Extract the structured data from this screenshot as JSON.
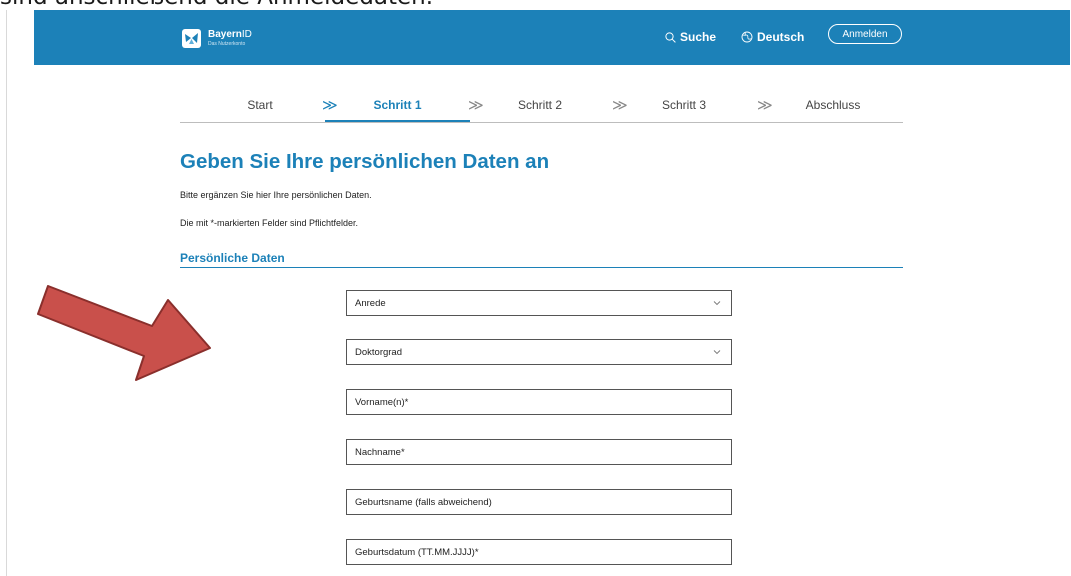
{
  "caption": "sind anschließend die Anmeldedaten.",
  "header": {
    "logo_name_bold": "Bayern",
    "logo_name_thin": "ID",
    "logo_sub": "Das Nutzerkonto",
    "search_label": "Suche",
    "language_label": "Deutsch",
    "login_label": "Anmelden",
    "icons": [
      "search-icon",
      "globe-icon"
    ]
  },
  "steps": {
    "items": [
      {
        "label": "Start",
        "active": false
      },
      {
        "label": "Schritt 1",
        "active": true
      },
      {
        "label": "Schritt 2",
        "active": false
      },
      {
        "label": "Schritt 3",
        "active": false
      },
      {
        "label": "Abschluss",
        "active": false
      }
    ],
    "separator": "≫"
  },
  "main": {
    "title": "Geben Sie Ihre persönlichen Daten an",
    "intro_1": "Bitte ergänzen Sie hier Ihre persönlichen Daten.",
    "intro_2": "Die mit *-markierten Felder sind Pflichtfelder.",
    "section_title": "Persönliche Daten"
  },
  "form": {
    "fields": [
      {
        "placeholder": "Anrede",
        "type": "select"
      },
      {
        "placeholder": "Doktorgrad",
        "type": "select"
      },
      {
        "placeholder": "Vorname(n)*",
        "type": "text"
      },
      {
        "placeholder": "Nachname*",
        "type": "text"
      },
      {
        "placeholder": "Geburtsname (falls abweichend)",
        "type": "text"
      },
      {
        "placeholder": "Geburtsdatum (TT.MM.JJJJ)*",
        "type": "text"
      }
    ]
  },
  "annotation": {
    "arrow_color": "#c9504b",
    "arrow_stroke": "#8a2f2c"
  },
  "colors": {
    "brand": "#1c81b8",
    "text": "#222222",
    "border": "#555555"
  }
}
